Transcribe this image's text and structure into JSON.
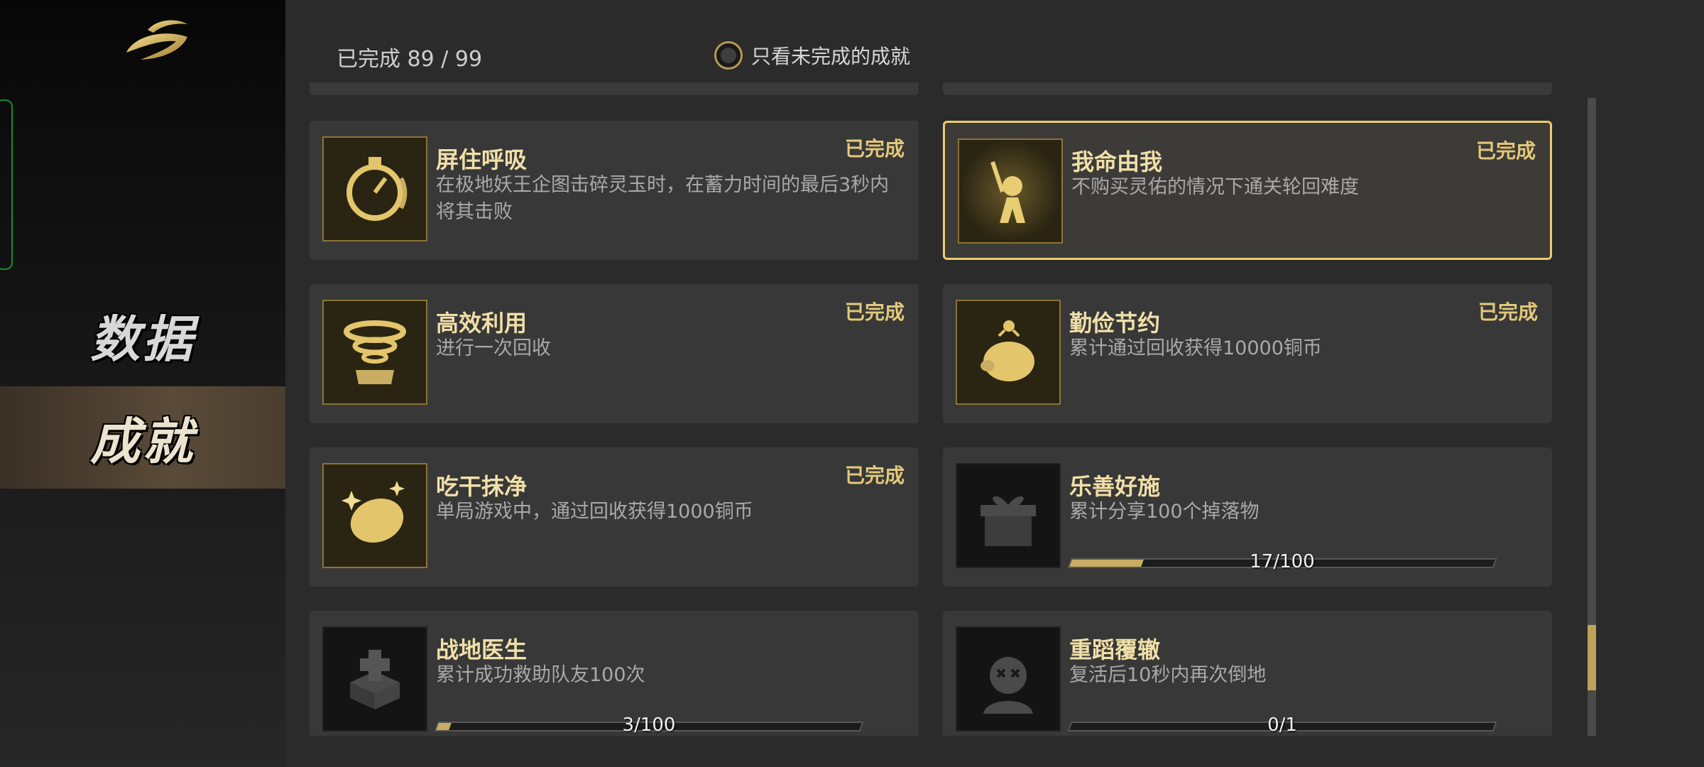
{
  "header": {
    "completed_text": "已完成 89 / 99",
    "filter_label": "只看未完成的成就"
  },
  "sidebar": {
    "items": [
      {
        "label": "数据",
        "active": false
      },
      {
        "label": "成就",
        "active": true
      }
    ]
  },
  "colors": {
    "accent": "#e8cd73",
    "title": "#f0dfa8",
    "card": "#383838",
    "progress_fill": "#c9ad62"
  },
  "achievements": [
    {
      "title": "屏住呼吸",
      "desc": "在极地妖王企图击碎灵玉时，在蓄力时间的最后3秒内将其击败",
      "status": "已完成",
      "icon": "stopwatch-icon",
      "completed": true
    },
    {
      "title": "我命由我",
      "desc": "不购买灵佑的情况下通关轮回难度",
      "status": "已完成",
      "icon": "raised-sword-figure-icon",
      "completed": true,
      "selected": true
    },
    {
      "title": "高效利用",
      "desc": "进行一次回收",
      "status": "已完成",
      "icon": "tornado-box-icon",
      "completed": true
    },
    {
      "title": "勤俭节约",
      "desc": "累计通过回收获得10000铜币",
      "status": "已完成",
      "icon": "piggy-bank-icon",
      "completed": true
    },
    {
      "title": "吃干抹净",
      "desc": "单局游戏中，通过回收获得1000铜币",
      "status": "已完成",
      "icon": "sparkling-coin-icon",
      "completed": true
    },
    {
      "title": "乐善好施",
      "desc": "累计分享100个掉落物",
      "status": "",
      "icon": "gift-box-icon",
      "completed": false,
      "progress_text": "17/100",
      "progress": 0.17
    },
    {
      "title": "战地医生",
      "desc": "累计成功救助队友100次",
      "status": "",
      "icon": "medical-box-icon",
      "completed": false,
      "progress_text": "3/100",
      "progress": 0.03
    },
    {
      "title": "重蹈覆辙",
      "desc": "复活后10秒内再次倒地",
      "status": "",
      "icon": "knocked-out-head-icon",
      "completed": false,
      "progress_text": "0/1",
      "progress": 0.0
    }
  ]
}
